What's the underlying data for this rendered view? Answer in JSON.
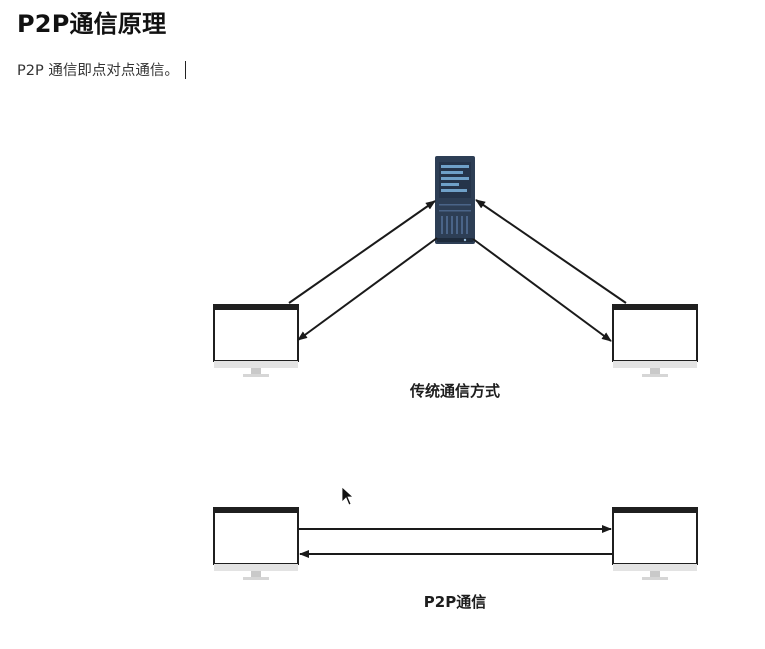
{
  "title": "P2P通信原理",
  "intro": "P2P 通信即点对点通信。",
  "diagrams": {
    "traditional": {
      "caption": "传统通信方式",
      "nodes": [
        "server",
        "client-left",
        "client-right"
      ]
    },
    "p2p": {
      "caption": "P2P通信",
      "nodes": [
        "peer-left",
        "peer-right"
      ]
    }
  },
  "colors": {
    "server_body": "#2d3e55",
    "server_screen": "#6fa0c8",
    "monitor_frame": "#1f1f1f",
    "arrow": "#1a1a1a",
    "caption": "#1d1d1d"
  }
}
